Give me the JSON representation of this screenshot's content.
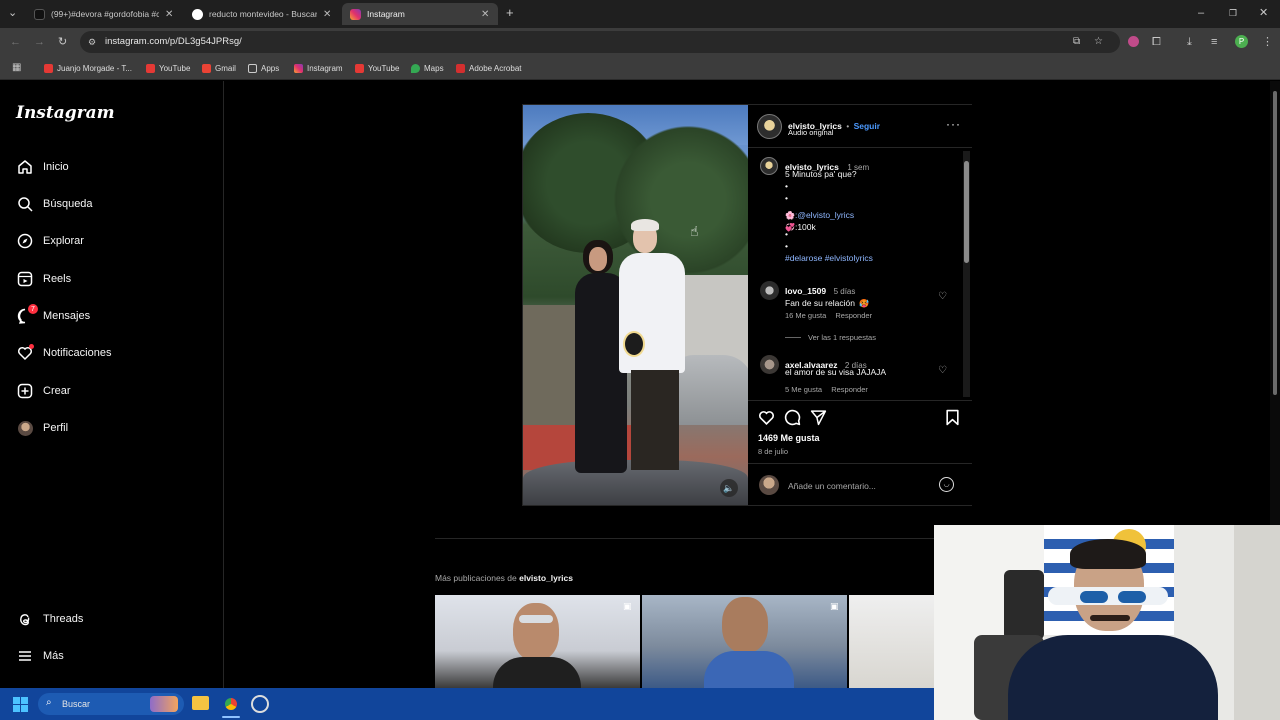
{
  "browser": {
    "tabs": [
      {
        "label": "(99+)#devora #gordofobia #co",
        "active": false,
        "favicon_color": "#111111"
      },
      {
        "label": "reducto montevideo - Buscar co",
        "active": false,
        "favicon_color": "#ffffff"
      },
      {
        "label": "Instagram",
        "active": true,
        "favicon_color": "#e1306c"
      }
    ],
    "url": "instagram.com/p/DL3g54JPRsg/",
    "bookmarks": [
      {
        "label": "Juanjo Morgade - T...",
        "icon": "youtube-icon"
      },
      {
        "label": "YouTube",
        "icon": "youtube-icon"
      },
      {
        "label": "Gmail",
        "icon": "gmail-icon"
      },
      {
        "label": "Apps",
        "icon": "folder-icon"
      },
      {
        "label": "Instagram",
        "icon": "instagram-icon"
      },
      {
        "label": "YouTube",
        "icon": "youtube-icon"
      },
      {
        "label": "Maps",
        "icon": "maps-icon"
      },
      {
        "label": "Adobe Acrobat",
        "icon": "acrobat-icon"
      }
    ]
  },
  "sidebar": {
    "logo": "Instagram",
    "items": [
      {
        "label": "Inicio",
        "icon": "home-icon"
      },
      {
        "label": "Búsqueda",
        "icon": "search-icon"
      },
      {
        "label": "Explorar",
        "icon": "compass-icon"
      },
      {
        "label": "Reels",
        "icon": "reels-icon"
      },
      {
        "label": "Mensajes",
        "icon": "messenger-icon",
        "badge": "7"
      },
      {
        "label": "Notificaciones",
        "icon": "heart-icon"
      },
      {
        "label": "Crear",
        "icon": "plus-square-icon"
      },
      {
        "label": "Perfil",
        "icon": "profile-avatar"
      }
    ],
    "bottom": [
      {
        "label": "Threads",
        "icon": "threads-icon"
      },
      {
        "label": "Más",
        "icon": "menu-icon"
      }
    ]
  },
  "post": {
    "author": "elvisto_lyrics",
    "separator": "•",
    "follow": "Seguir",
    "audio": "Audio original",
    "caption": {
      "author": "elvisto_lyrics",
      "time": "1 sem",
      "line1": "5 Minutos pa' que?",
      "dot1": "•",
      "dot2": "•",
      "mention": ":@elvisto_lyrics",
      "stat": ":100k",
      "dot3": "•",
      "dot4": "•",
      "hashtags": "#delarose #elvistolyrics"
    },
    "comments": [
      {
        "user": "lovo_1509",
        "time": "5 días",
        "text": "Fan de su relación",
        "likes": "16 Me gusta",
        "reply": "Responder",
        "view_replies": "Ver las 1 respuestas"
      },
      {
        "user": "axel.alvaarez",
        "time": "2 días",
        "text": "el amor de su visa JAJAJA",
        "likes": "5 Me gusta",
        "reply": "Responder"
      }
    ],
    "likes": "1469 Me gusta",
    "date": "8 de julio",
    "comment_placeholder": "Añade un comentario..."
  },
  "more": {
    "prefix": "Más publicaciones de ",
    "author": "elvisto_lyrics"
  },
  "taskbar": {
    "search_label": "Buscar"
  },
  "colors": {
    "accent_blue": "#4c9aff",
    "badge_red": "#ff3040",
    "taskbar": "#11459b"
  }
}
